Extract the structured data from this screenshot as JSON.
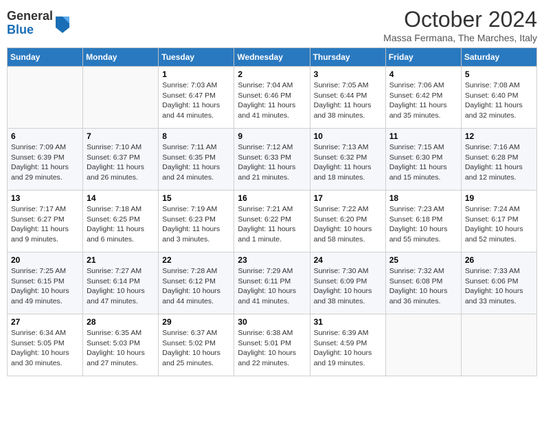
{
  "header": {
    "logo_general": "General",
    "logo_blue": "Blue",
    "month_title": "October 2024",
    "location": "Massa Fermana, The Marches, Italy"
  },
  "days_of_week": [
    "Sunday",
    "Monday",
    "Tuesday",
    "Wednesday",
    "Thursday",
    "Friday",
    "Saturday"
  ],
  "weeks": [
    [
      {
        "day": "",
        "sunrise": "",
        "sunset": "",
        "daylight": ""
      },
      {
        "day": "",
        "sunrise": "",
        "sunset": "",
        "daylight": ""
      },
      {
        "day": "1",
        "sunrise": "Sunrise: 7:03 AM",
        "sunset": "Sunset: 6:47 PM",
        "daylight": "Daylight: 11 hours and 44 minutes."
      },
      {
        "day": "2",
        "sunrise": "Sunrise: 7:04 AM",
        "sunset": "Sunset: 6:46 PM",
        "daylight": "Daylight: 11 hours and 41 minutes."
      },
      {
        "day": "3",
        "sunrise": "Sunrise: 7:05 AM",
        "sunset": "Sunset: 6:44 PM",
        "daylight": "Daylight: 11 hours and 38 minutes."
      },
      {
        "day": "4",
        "sunrise": "Sunrise: 7:06 AM",
        "sunset": "Sunset: 6:42 PM",
        "daylight": "Daylight: 11 hours and 35 minutes."
      },
      {
        "day": "5",
        "sunrise": "Sunrise: 7:08 AM",
        "sunset": "Sunset: 6:40 PM",
        "daylight": "Daylight: 11 hours and 32 minutes."
      }
    ],
    [
      {
        "day": "6",
        "sunrise": "Sunrise: 7:09 AM",
        "sunset": "Sunset: 6:39 PM",
        "daylight": "Daylight: 11 hours and 29 minutes."
      },
      {
        "day": "7",
        "sunrise": "Sunrise: 7:10 AM",
        "sunset": "Sunset: 6:37 PM",
        "daylight": "Daylight: 11 hours and 26 minutes."
      },
      {
        "day": "8",
        "sunrise": "Sunrise: 7:11 AM",
        "sunset": "Sunset: 6:35 PM",
        "daylight": "Daylight: 11 hours and 24 minutes."
      },
      {
        "day": "9",
        "sunrise": "Sunrise: 7:12 AM",
        "sunset": "Sunset: 6:33 PM",
        "daylight": "Daylight: 11 hours and 21 minutes."
      },
      {
        "day": "10",
        "sunrise": "Sunrise: 7:13 AM",
        "sunset": "Sunset: 6:32 PM",
        "daylight": "Daylight: 11 hours and 18 minutes."
      },
      {
        "day": "11",
        "sunrise": "Sunrise: 7:15 AM",
        "sunset": "Sunset: 6:30 PM",
        "daylight": "Daylight: 11 hours and 15 minutes."
      },
      {
        "day": "12",
        "sunrise": "Sunrise: 7:16 AM",
        "sunset": "Sunset: 6:28 PM",
        "daylight": "Daylight: 11 hours and 12 minutes."
      }
    ],
    [
      {
        "day": "13",
        "sunrise": "Sunrise: 7:17 AM",
        "sunset": "Sunset: 6:27 PM",
        "daylight": "Daylight: 11 hours and 9 minutes."
      },
      {
        "day": "14",
        "sunrise": "Sunrise: 7:18 AM",
        "sunset": "Sunset: 6:25 PM",
        "daylight": "Daylight: 11 hours and 6 minutes."
      },
      {
        "day": "15",
        "sunrise": "Sunrise: 7:19 AM",
        "sunset": "Sunset: 6:23 PM",
        "daylight": "Daylight: 11 hours and 3 minutes."
      },
      {
        "day": "16",
        "sunrise": "Sunrise: 7:21 AM",
        "sunset": "Sunset: 6:22 PM",
        "daylight": "Daylight: 11 hours and 1 minute."
      },
      {
        "day": "17",
        "sunrise": "Sunrise: 7:22 AM",
        "sunset": "Sunset: 6:20 PM",
        "daylight": "Daylight: 10 hours and 58 minutes."
      },
      {
        "day": "18",
        "sunrise": "Sunrise: 7:23 AM",
        "sunset": "Sunset: 6:18 PM",
        "daylight": "Daylight: 10 hours and 55 minutes."
      },
      {
        "day": "19",
        "sunrise": "Sunrise: 7:24 AM",
        "sunset": "Sunset: 6:17 PM",
        "daylight": "Daylight: 10 hours and 52 minutes."
      }
    ],
    [
      {
        "day": "20",
        "sunrise": "Sunrise: 7:25 AM",
        "sunset": "Sunset: 6:15 PM",
        "daylight": "Daylight: 10 hours and 49 minutes."
      },
      {
        "day": "21",
        "sunrise": "Sunrise: 7:27 AM",
        "sunset": "Sunset: 6:14 PM",
        "daylight": "Daylight: 10 hours and 47 minutes."
      },
      {
        "day": "22",
        "sunrise": "Sunrise: 7:28 AM",
        "sunset": "Sunset: 6:12 PM",
        "daylight": "Daylight: 10 hours and 44 minutes."
      },
      {
        "day": "23",
        "sunrise": "Sunrise: 7:29 AM",
        "sunset": "Sunset: 6:11 PM",
        "daylight": "Daylight: 10 hours and 41 minutes."
      },
      {
        "day": "24",
        "sunrise": "Sunrise: 7:30 AM",
        "sunset": "Sunset: 6:09 PM",
        "daylight": "Daylight: 10 hours and 38 minutes."
      },
      {
        "day": "25",
        "sunrise": "Sunrise: 7:32 AM",
        "sunset": "Sunset: 6:08 PM",
        "daylight": "Daylight: 10 hours and 36 minutes."
      },
      {
        "day": "26",
        "sunrise": "Sunrise: 7:33 AM",
        "sunset": "Sunset: 6:06 PM",
        "daylight": "Daylight: 10 hours and 33 minutes."
      }
    ],
    [
      {
        "day": "27",
        "sunrise": "Sunrise: 6:34 AM",
        "sunset": "Sunset: 5:05 PM",
        "daylight": "Daylight: 10 hours and 30 minutes."
      },
      {
        "day": "28",
        "sunrise": "Sunrise: 6:35 AM",
        "sunset": "Sunset: 5:03 PM",
        "daylight": "Daylight: 10 hours and 27 minutes."
      },
      {
        "day": "29",
        "sunrise": "Sunrise: 6:37 AM",
        "sunset": "Sunset: 5:02 PM",
        "daylight": "Daylight: 10 hours and 25 minutes."
      },
      {
        "day": "30",
        "sunrise": "Sunrise: 6:38 AM",
        "sunset": "Sunset: 5:01 PM",
        "daylight": "Daylight: 10 hours and 22 minutes."
      },
      {
        "day": "31",
        "sunrise": "Sunrise: 6:39 AM",
        "sunset": "Sunset: 4:59 PM",
        "daylight": "Daylight: 10 hours and 19 minutes."
      },
      {
        "day": "",
        "sunrise": "",
        "sunset": "",
        "daylight": ""
      },
      {
        "day": "",
        "sunrise": "",
        "sunset": "",
        "daylight": ""
      }
    ]
  ]
}
